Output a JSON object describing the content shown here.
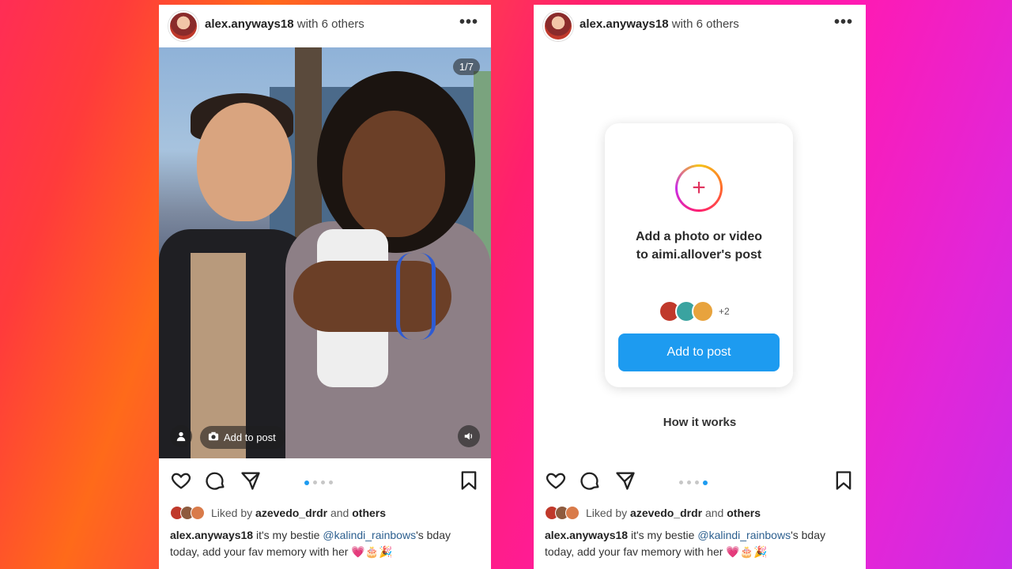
{
  "posts": [
    {
      "header": {
        "username": "alex.anyways18",
        "with_text": "with 6 others",
        "more": "•••"
      },
      "counter": "1/7",
      "add_chip": "Add to post",
      "likes": {
        "prefix": "Liked by",
        "user": "azevedo_drdr",
        "suffix": "and",
        "others": "others"
      },
      "caption": {
        "username": "alex.anyways18",
        "text_before": " it's my bestie ",
        "mention": "@kalindi_rainbows",
        "text_after": "'s bday today, add your fav memory with her 💗🎂🎉"
      }
    },
    {
      "header": {
        "username": "alex.anyways18",
        "with_text": "with 6 others",
        "more": "•••"
      },
      "add_card": {
        "title_line1": "Add a photo or video",
        "title_line2": "to aimi.allover's post",
        "contributors_extra": "+2",
        "button": "Add to post"
      },
      "how_it_works": "How it works",
      "likes": {
        "prefix": "Liked by",
        "user": "azevedo_drdr",
        "suffix": "and",
        "others": "others"
      },
      "caption": {
        "username": "alex.anyways18",
        "text_before": " it's my bestie ",
        "mention": "@kalindi_rainbows",
        "text_after": "'s bday today, add your fav memory with her 💗🎂🎉"
      }
    }
  ],
  "icons": {
    "camera": "camera-icon",
    "person": "person-tag-icon",
    "sound": "sound-icon",
    "heart": "heart-icon",
    "comment": "comment-icon",
    "share": "send-icon",
    "bookmark": "bookmark-icon",
    "plus": "plus-icon"
  },
  "colors": {
    "primary_button": "#1d9bf0",
    "carousel_active": "#1d9bf0"
  }
}
